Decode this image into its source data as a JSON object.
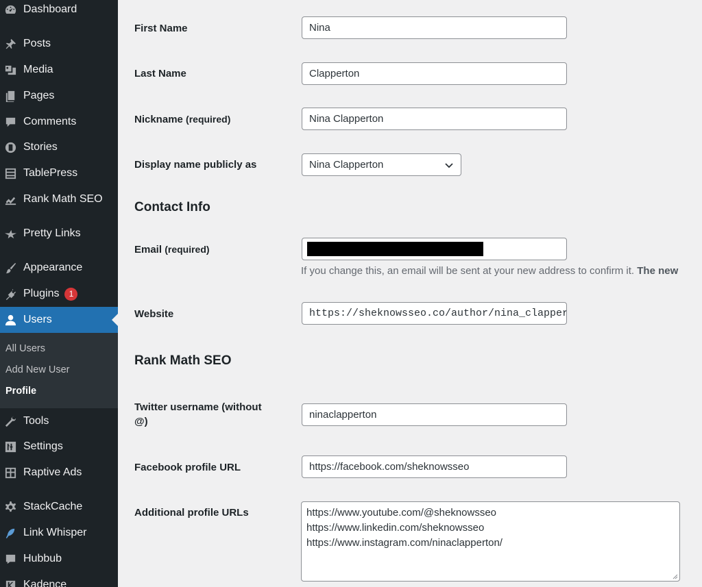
{
  "sidebar": {
    "items": [
      {
        "label": "Dashboard",
        "icon": "dashboard-icon"
      },
      {
        "label": "Posts",
        "icon": "pushpin-icon"
      },
      {
        "label": "Media",
        "icon": "media-icon"
      },
      {
        "label": "Pages",
        "icon": "pages-icon"
      },
      {
        "label": "Comments",
        "icon": "comment-icon"
      },
      {
        "label": "Stories",
        "icon": "stories-icon"
      },
      {
        "label": "TablePress",
        "icon": "table-icon"
      },
      {
        "label": "Rank Math SEO",
        "icon": "chart-icon"
      },
      {
        "label": "Pretty Links",
        "icon": "star-link-icon"
      },
      {
        "label": "Appearance",
        "icon": "paintbrush-icon"
      },
      {
        "label": "Plugins",
        "icon": "plug-icon",
        "badge": "1"
      },
      {
        "label": "Users",
        "icon": "user-icon"
      },
      {
        "label": "Tools",
        "icon": "wrench-icon"
      },
      {
        "label": "Settings",
        "icon": "settings-icon"
      },
      {
        "label": "Raptive Ads",
        "icon": "grid-icon"
      },
      {
        "label": "StackCache",
        "icon": "gear-icon"
      },
      {
        "label": "Link Whisper",
        "icon": "feather-icon"
      },
      {
        "label": "Hubbub",
        "icon": "hubbub-icon"
      },
      {
        "label": "Kadence",
        "icon": "kadence-icon"
      }
    ],
    "submenu": [
      "All Users",
      "Add New User",
      "Profile"
    ]
  },
  "form": {
    "first_name": {
      "label": "First Name",
      "value": "Nina"
    },
    "last_name": {
      "label": "Last Name",
      "value": "Clapperton"
    },
    "nickname": {
      "label": "Nickname",
      "req": "(required)",
      "value": "Nina Clapperton"
    },
    "display_name": {
      "label": "Display name publicly as",
      "value": "Nina Clapperton"
    },
    "contact_title": "Contact Info",
    "email": {
      "label": "Email",
      "req": "(required)",
      "desc": "If you change this, an email will be sent at your new address to confirm it.",
      "desc_bold": "The new"
    },
    "website": {
      "label": "Website",
      "value": "https://sheknowsseo.co/author/nina_clapperton/"
    },
    "rankmath_title": "Rank Math SEO",
    "twitter": {
      "label_line1": "Twitter username (without",
      "label_line2": "@)",
      "value": "ninaclapperton"
    },
    "facebook": {
      "label": "Facebook profile URL",
      "value": "https://facebook.com/sheknowsseo"
    },
    "additional": {
      "label": "Additional profile URLs",
      "lines": [
        "https://www.youtube.com/@sheknowsseo",
        "https://www.linkedin.com/sheknowsseo",
        "https://www.instagram.com/ninaclapperton/"
      ]
    }
  },
  "colors": {
    "sidebar_bg": "#1d2327",
    "active_bg": "#2271b1",
    "badge": "#d63638",
    "page_bg": "#f0f0f1"
  }
}
